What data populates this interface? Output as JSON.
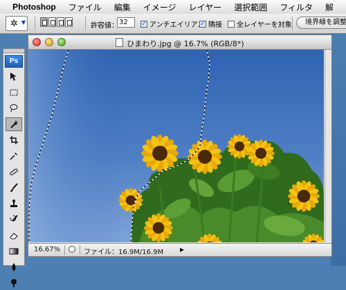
{
  "menubar": {
    "apple_glyph": "",
    "app_name": "Photoshop",
    "items": [
      "ファイル",
      "編集",
      "イメージ",
      "レイヤー",
      "選択範囲",
      "フィルタ",
      "解"
    ]
  },
  "options_bar": {
    "tool_icon": "magic-wand-icon",
    "tolerance_label": "許容値：",
    "tolerance_value": "32",
    "antialias_label": "アンチエイリアス",
    "antialias_checked": true,
    "contiguous_label": "隣接",
    "contiguous_checked": true,
    "all_layers_label": "全レイヤーを対象",
    "all_layers_checked": false,
    "refine_edge_label": "境界線を調整..."
  },
  "toolbox": {
    "logo": "Ps",
    "tools": [
      "move-tool-icon",
      "marquee-tool-icon",
      "lasso-tool-icon",
      "magic-wand-tool-icon",
      "crop-tool-icon",
      "eyedropper-tool-icon",
      "healing-brush-tool-icon",
      "brush-tool-icon",
      "stamp-tool-icon",
      "history-brush-tool-icon",
      "eraser-tool-icon",
      "gradient-tool-icon",
      "blur-tool-icon",
      "dodge-tool-icon"
    ],
    "active_tool": "magic-wand-tool-icon"
  },
  "document": {
    "title": "ひまわり.jpg @ 16.7% (RGB/8*)",
    "zoom": "16.67%",
    "file_info": "ファイル：16.9M/16.9M"
  },
  "colors": {
    "sky_top": "#2e63b3",
    "sky_bottom": "#7ea3d8",
    "petal": "#f5c313",
    "center": "#4a2a0a",
    "leaf": "#3e7a25"
  }
}
